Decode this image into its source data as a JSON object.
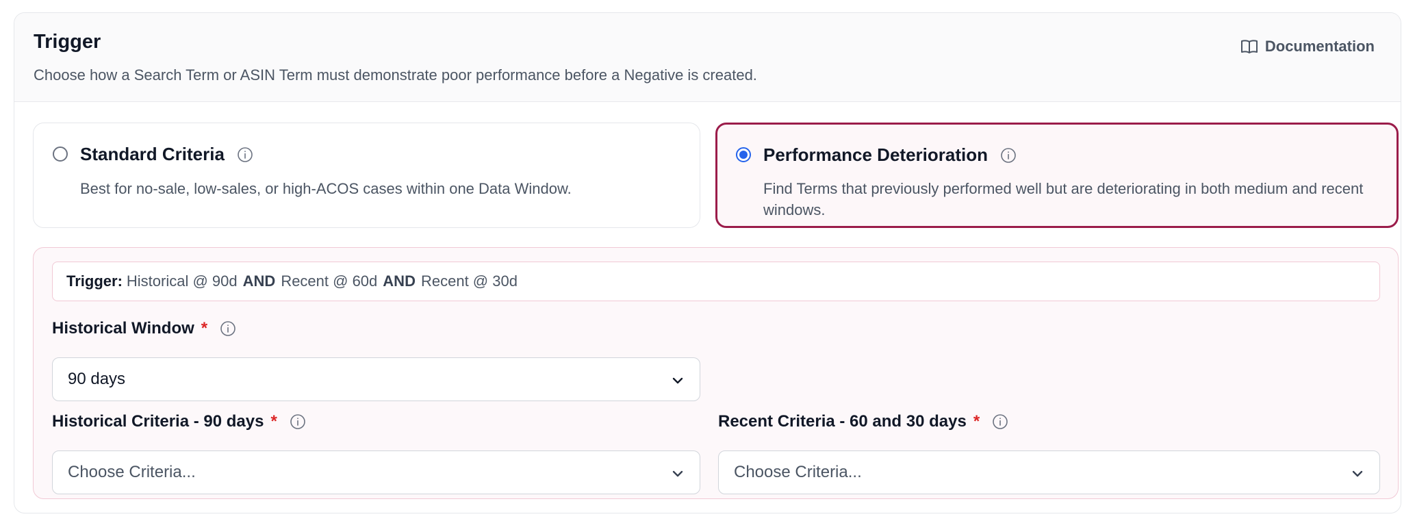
{
  "header": {
    "title": "Trigger",
    "subtitle": "Choose how a Search Term or ASIN Term must demonstrate poor performance before a Negative is created.",
    "documentation_label": "Documentation"
  },
  "options": [
    {
      "title": "Standard Criteria",
      "description": "Best for no-sale, low-sales, or high-ACOS cases within one Data Window.",
      "selected": false
    },
    {
      "title": "Performance Deterioration",
      "description": "Find Terms that previously performed well but are deteriorating in both medium and recent windows.",
      "selected": true
    }
  ],
  "trigger_summary": {
    "label": "Trigger:",
    "part1": "Historical @ 90d",
    "op1": "AND",
    "part2": "Recent @ 60d",
    "op2": "AND",
    "part3": "Recent @ 30d"
  },
  "historical_window": {
    "label": "Historical Window",
    "required_mark": "*",
    "value": "90 days"
  },
  "historical_criteria": {
    "label": "Historical Criteria - 90 days",
    "required_mark": "*",
    "placeholder": "Choose Criteria..."
  },
  "recent_criteria": {
    "label": "Recent Criteria - 60 and 30 days",
    "required_mark": "*",
    "placeholder": "Choose Criteria..."
  },
  "colors": {
    "accent": "#9b1c4a",
    "radio_selected": "#2563eb",
    "required": "#dc2626"
  },
  "icons": [
    "book-icon",
    "info-icon",
    "chevron-down-icon"
  ]
}
